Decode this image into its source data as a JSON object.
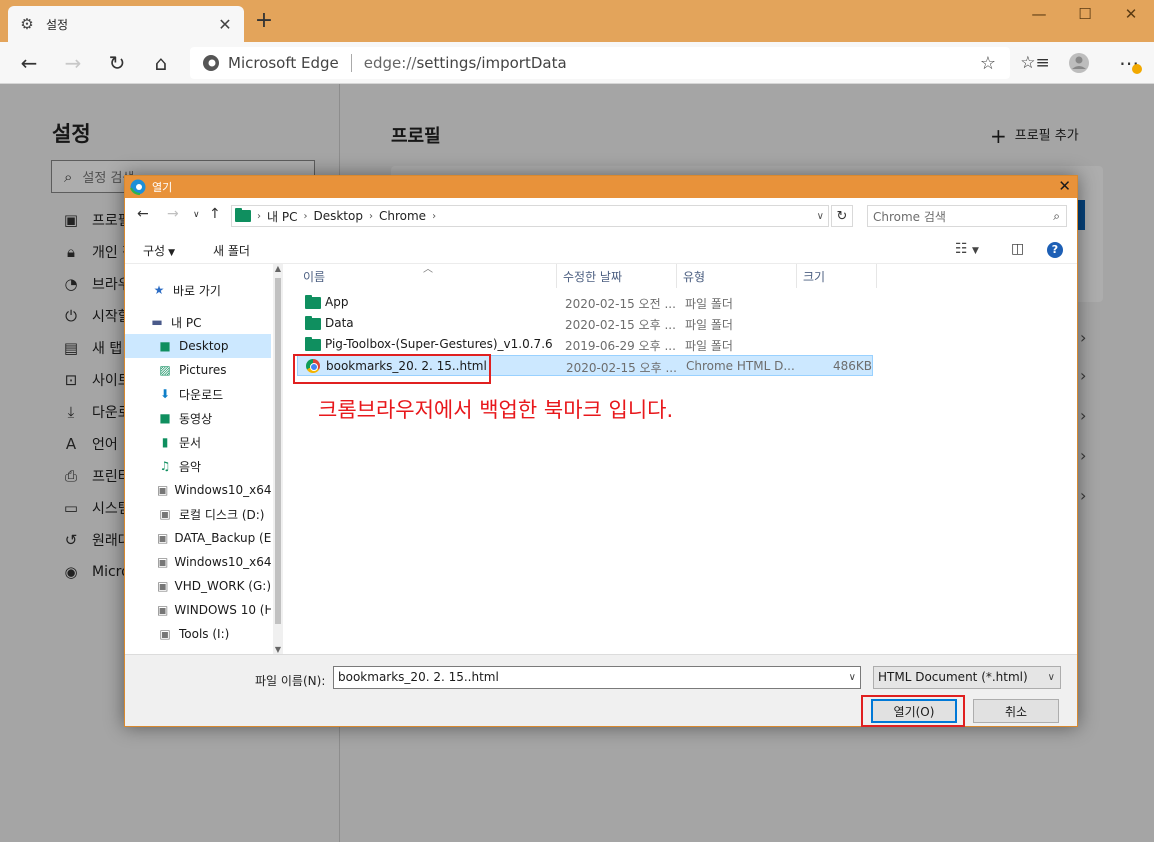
{
  "browser": {
    "tab_title": "설정",
    "address_site": "Microsoft Edge",
    "address_url_scheme": "edge://",
    "address_url_path": "settings/importData"
  },
  "settings": {
    "sidebar_title": "설정",
    "search_placeholder": "설정 검색",
    "nav_items": [
      "프로필",
      "개인 정",
      "브라우",
      "시작할",
      "새 탭",
      "사이트",
      "다운로",
      "언어",
      "프린터",
      "시스템",
      "원래대",
      "Micro"
    ],
    "main_title": "프로필",
    "add_profile": "프로필 추가"
  },
  "dialog": {
    "title": "열기",
    "path": [
      "내 PC",
      "Desktop",
      "Chrome"
    ],
    "search_placeholder": "Chrome 검색",
    "cmd_organize": "구성",
    "cmd_new_folder": "새 폴더",
    "tree": [
      {
        "label": "바로 가기",
        "icon": "star-icon"
      },
      {
        "label": "내 PC",
        "icon": "pc-icon"
      },
      {
        "label": "Desktop",
        "icon": "desktop-folder-icon"
      },
      {
        "label": "Pictures",
        "icon": "pictures-icon"
      },
      {
        "label": "다운로드",
        "icon": "download-icon"
      },
      {
        "label": "동영상",
        "icon": "video-icon"
      },
      {
        "label": "문서",
        "icon": "document-icon"
      },
      {
        "label": "음악",
        "icon": "music-icon"
      },
      {
        "label": "Windows10_x64",
        "icon": "drive-icon"
      },
      {
        "label": "로컬 디스크 (D:)",
        "icon": "drive-icon"
      },
      {
        "label": "DATA_Backup (E",
        "icon": "drive-icon"
      },
      {
        "label": "Windows10_x64",
        "icon": "drive-icon"
      },
      {
        "label": "VHD_WORK (G:)",
        "icon": "drive-icon"
      },
      {
        "label": "WINDOWS 10 (H",
        "icon": "drive-icon"
      },
      {
        "label": "Tools (I:)",
        "icon": "drive-icon"
      }
    ],
    "columns": [
      "이름",
      "수정한 날짜",
      "유형",
      "크기"
    ],
    "files": [
      {
        "name": "App",
        "date": "2020-02-15 오전 ...",
        "type": "파일 폴더",
        "size": "",
        "icon": "folder-icon"
      },
      {
        "name": "Data",
        "date": "2020-02-15 오후 ...",
        "type": "파일 폴더",
        "size": "",
        "icon": "folder-icon"
      },
      {
        "name": "Pig-Toolbox-(Super-Gestures)_v1.0.7.6",
        "date": "2019-06-29 오후 ...",
        "type": "파일 폴더",
        "size": "",
        "icon": "folder-icon"
      },
      {
        "name": "bookmarks_20. 2. 15..html",
        "date": "2020-02-15 오후 ...",
        "type": "Chrome HTML D...",
        "size": "486KB",
        "icon": "chrome-icon"
      }
    ],
    "annotation": "크롬브라우저에서 백업한 북마크 입니다.",
    "filename_label": "파일 이름(N):",
    "filename_value": "bookmarks_20. 2. 15..html",
    "filter_value": "HTML Document (*.html)",
    "open_button": "열기(O)",
    "cancel_button": "취소"
  }
}
